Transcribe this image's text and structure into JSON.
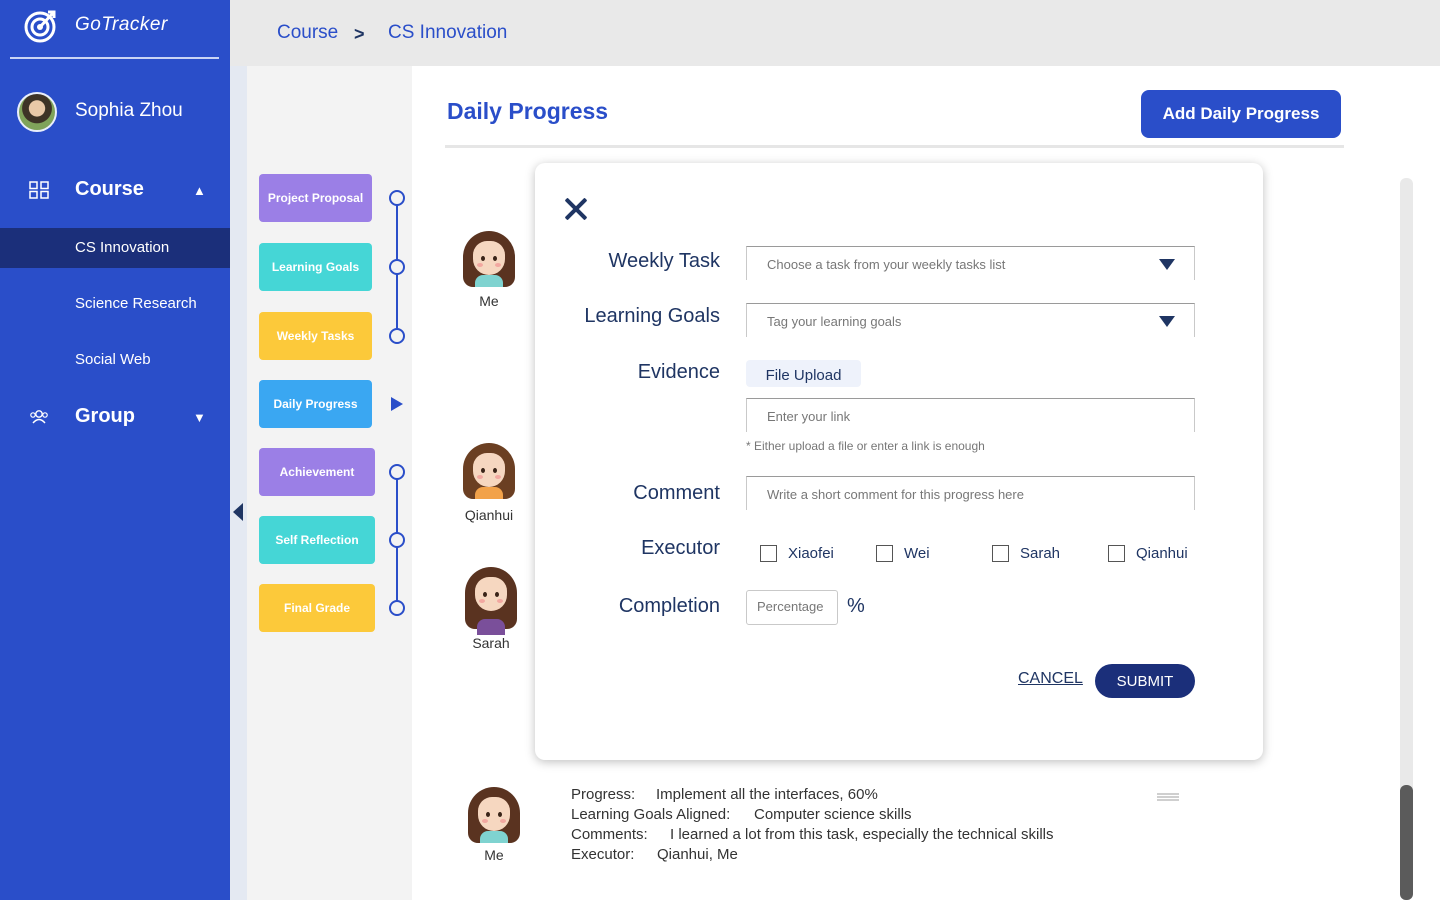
{
  "app": {
    "name": "GoTracker"
  },
  "user": {
    "name": "Sophia Zhou"
  },
  "sidebar": {
    "course_label": "Course",
    "group_label": "Group",
    "courses": [
      {
        "label": "CS Innovation",
        "active": true
      },
      {
        "label": "Science Research",
        "active": false
      },
      {
        "label": "Social Web",
        "active": false
      }
    ]
  },
  "breadcrumb": {
    "root": "Course",
    "current": "CS Innovation"
  },
  "steps": [
    {
      "label": "Project Proposal",
      "color": "#9b7fe6"
    },
    {
      "label": "Learning Goals",
      "color": "#45d6d6"
    },
    {
      "label": "Weekly Tasks",
      "color": "#fcc93a"
    },
    {
      "label": "Daily Progress",
      "color": "#3aa7f2"
    },
    {
      "label": "Achievement",
      "color": "#9b7fe6"
    },
    {
      "label": "Self Reflection",
      "color": "#45d6d6"
    },
    {
      "label": "Final Grade",
      "color": "#fcc93a"
    }
  ],
  "main": {
    "title": "Daily Progress",
    "add_button": "Add Daily Progress",
    "members": [
      {
        "name": "Me",
        "shirt": "#7fd3d0"
      },
      {
        "name": "Qianhui",
        "shirt": "#f2a24a"
      },
      {
        "name": "Sarah",
        "shirt": "#7a4f9a"
      },
      {
        "name": "Me",
        "shirt": "#7fd3d0"
      }
    ],
    "entry": {
      "progress_label": "Progress:",
      "progress_value": "Implement all the interfaces, 60%",
      "goals_label": "Learning Goals Aligned:",
      "goals_value": "Computer science skills",
      "comments_label": "Comments:",
      "comments_value": "I learned a lot from this task, especially the technical skills",
      "executor_label": "Executor:",
      "executor_value": "Qianhui, Me"
    }
  },
  "modal": {
    "weekly_task_label": "Weekly Task",
    "weekly_task_placeholder": "Choose a task from your weekly tasks list",
    "learning_goals_label": "Learning Goals",
    "learning_goals_placeholder": "Tag your learning goals",
    "evidence_label": "Evidence",
    "upload_button": "File Upload",
    "link_placeholder": "Enter your link",
    "evidence_hint": "* Either upload a file or enter a link is enough",
    "comment_label": "Comment",
    "comment_placeholder": "Write a short comment for this progress here",
    "executor_label": "Executor",
    "executors": [
      "Xiaofei",
      "Wei",
      "Sarah",
      "Qianhui"
    ],
    "completion_label": "Completion",
    "completion_placeholder": "Percentage",
    "percent_symbol": "%",
    "cancel_label": "CANCEL",
    "submit_label": "SUBMIT"
  }
}
